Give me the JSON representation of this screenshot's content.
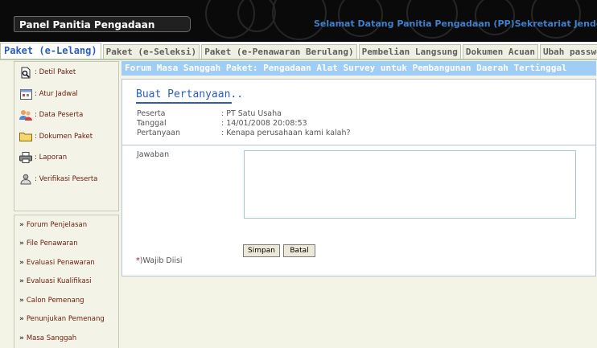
{
  "header": {
    "panel_title": "Panel Panitia Pengadaan",
    "welcome_text": "Selamat Datang Panitia Pengadaan (PP)Sekretariat Jenderal"
  },
  "tabs": [
    {
      "label": "Paket (e-Lelang)",
      "active": true
    },
    {
      "label": "Paket (e-Seleksi)",
      "active": false
    },
    {
      "label": "Paket (e-Penawaran Berulang)",
      "active": false
    },
    {
      "label": "Pembelian Langsung",
      "active": false
    },
    {
      "label": "Dokumen Acuan",
      "active": false
    },
    {
      "label": "Ubah password",
      "active": false
    }
  ],
  "sidebar": {
    "group1": [
      {
        "label": ": Detil Paket",
        "icon": "document-search-icon"
      },
      {
        "label": ": Atur Jadwal",
        "icon": "calendar-icon"
      },
      {
        "label": ": Data Peserta",
        "icon": "users-icon"
      },
      {
        "label": ": Dokumen Paket",
        "icon": "folder-icon"
      },
      {
        "label": ": Laporan",
        "icon": "printer-icon"
      },
      {
        "label": ": Verifikasi Peserta",
        "icon": "verify-user-icon"
      }
    ],
    "group2": [
      {
        "label": "Forum Penjelasan"
      },
      {
        "label": "File Penawaran"
      },
      {
        "label": "Evaluasi Penawaran"
      },
      {
        "label": "Evaluasi Kualifikasi"
      },
      {
        "label": "Calon Pemenang"
      },
      {
        "label": "Penunjukan Pemenang"
      },
      {
        "label": "Masa Sanggah"
      }
    ]
  },
  "main": {
    "title": "Forum Masa Sanggah Paket: Pengadaan Alat Survey untuk Pembangunan Daerah Tertinggal",
    "form_title": "Buat Pertanyaan..",
    "fields": [
      {
        "label": "Peserta",
        "value": ": PT Satu Usaha"
      },
      {
        "label": "Tanggal",
        "value": ": 14/01/2008 20:08:53"
      },
      {
        "label": "Pertanyaan",
        "value": ": Kenapa perusahaan kami kalah?"
      }
    ],
    "answer_label": "Jawaban",
    "answer_value": "",
    "buttons": {
      "save": "Simpan",
      "cancel": "Batal"
    },
    "required_star": "*",
    "required_note": ")Wajib Diisi"
  },
  "colors": {
    "header_bg": "#0a0a0a",
    "welcome_text": "#3e7fce",
    "active_tab": "#2a5fb8",
    "title_bar": "#a0cdf5",
    "sidebar_text": "#6a1c0c",
    "required_star": "#d00000"
  }
}
